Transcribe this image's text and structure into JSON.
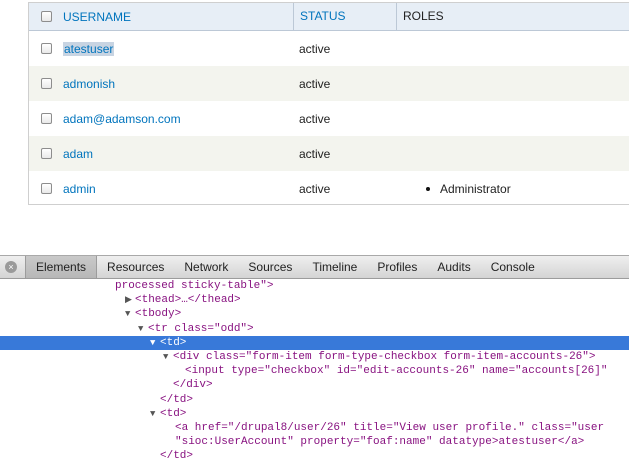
{
  "table": {
    "headers": {
      "username": "USERNAME",
      "status": "STATUS",
      "roles": "ROLES"
    },
    "rows": [
      {
        "username": "atestuser",
        "status": "active",
        "role": ""
      },
      {
        "username": "admonish",
        "status": "active",
        "role": ""
      },
      {
        "username": "adam@adamson.com",
        "status": "active",
        "role": ""
      },
      {
        "username": "adam",
        "status": "active",
        "role": ""
      },
      {
        "username": "admin",
        "status": "active",
        "role": "Administrator"
      }
    ]
  },
  "devtools": {
    "close_icon": "×",
    "tabs": [
      "Elements",
      "Resources",
      "Network",
      "Sources",
      "Timeline",
      "Profiles",
      "Audits",
      "Console"
    ],
    "lines": [
      {
        "text": "processed sticky-table\">"
      },
      {
        "text": "<thead>…</thead>"
      },
      {
        "text": "<tbody>"
      },
      {
        "text": "<tr class=\"odd\">"
      },
      {
        "text": "<td>"
      },
      {
        "text": "<div class=\"form-item form-type-checkbox form-item-accounts-26\">"
      },
      {
        "text": "<input type=\"checkbox\" id=\"edit-accounts-26\" name=\"accounts[26]\""
      },
      {
        "text": "</div>"
      },
      {
        "text": "</td>"
      },
      {
        "text": "<td>"
      },
      {
        "text": "<a href=\"/drupal8/user/26\" title=\"View user profile.\" class=\"user"
      },
      {
        "text": "\"sioc:UserAccount\" property=\"foaf:name\" datatype>atestuser</a>"
      },
      {
        "text": "</td>"
      }
    ]
  }
}
